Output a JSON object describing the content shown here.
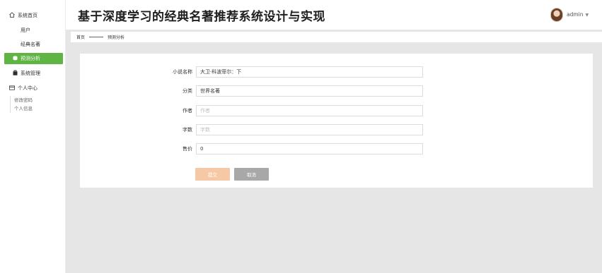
{
  "app": {
    "title": "基于深度学习的经典名著推荐系统设计与实现"
  },
  "user": {
    "name": "admin",
    "caret": "▼"
  },
  "sidebar": {
    "items": [
      {
        "label": "系统首页",
        "icon": "home-icon"
      },
      {
        "label": "用户",
        "icon": "grid-icon"
      },
      {
        "label": "经典名著",
        "icon": "grid-icon"
      },
      {
        "label": "预测分析",
        "icon": "database-icon",
        "active": true
      },
      {
        "label": "系统管理",
        "icon": "bag-icon"
      },
      {
        "label": "个人中心",
        "icon": "card-icon"
      }
    ],
    "sub_items": [
      {
        "label": "修改密码"
      },
      {
        "label": "个人信息"
      }
    ]
  },
  "breadcrumb": {
    "home": "首页",
    "current": "预测分析"
  },
  "form": {
    "fields": [
      {
        "label": "小说名称",
        "value": "大卫·科波菲尔：下",
        "placeholder": ""
      },
      {
        "label": "分类",
        "value": "世界名著",
        "placeholder": ""
      },
      {
        "label": "作者",
        "value": "",
        "placeholder": "作者"
      },
      {
        "label": "字数",
        "value": "",
        "placeholder": "字数"
      },
      {
        "label": "售价",
        "value": "0",
        "placeholder": ""
      }
    ],
    "submit_label": "提交",
    "cancel_label": "取消"
  },
  "colors": {
    "accent": "#5fb443",
    "submit": "#f7c8a5",
    "cancel": "#a8a8a8"
  }
}
